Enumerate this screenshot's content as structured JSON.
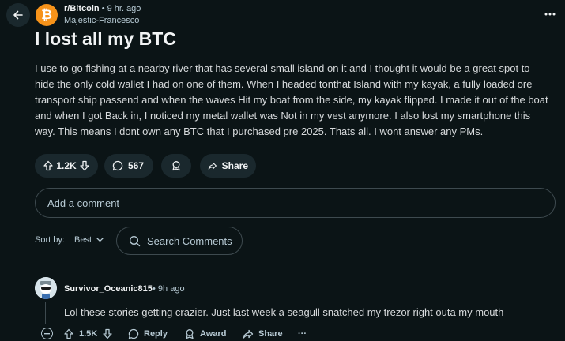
{
  "header": {
    "subreddit": "r/Bitcoin",
    "separator": "•",
    "time_ago": "9 hr. ago",
    "author": "Majestic-Francesco",
    "subreddit_avatar_letter": "₿"
  },
  "post": {
    "title": "I lost all my BTC",
    "body": "I use to go fishing at a nearby river that has several small island on it and I thought it would be a great spot to hide the only cold wallet I had on one of them. When I headed tonthat Island with my kayak, a fully loaded ore transport ship passend and when the waves Hit my boat from the side, my kayak flipped. I made it out of the boat and when I got Back in, I noticed my metal wallet was Not in my vest anymore. I also lost my smartphone this way. This means I dont own any BTC that I purchased pre 2025. Thats all. I wont answer any PMs.",
    "vote_count": "1.2K",
    "comment_count": "567",
    "share_label": "Share"
  },
  "comment_input": {
    "placeholder": "Add a comment"
  },
  "sort": {
    "label": "Sort by:",
    "value": "Best"
  },
  "search_comments": {
    "placeholder": "Search Comments"
  },
  "comments": [
    {
      "author": "Survivor_Oceanic815",
      "separator": "•",
      "time_ago": "9h ago",
      "text": "Lol these stories getting crazier. Just last week a seagull snatched my trezor right outa my mouth",
      "vote_count": "1.5K",
      "reply_label": "Reply",
      "award_label": "Award",
      "share_label": "Share",
      "more_label": "···"
    }
  ],
  "colors": {
    "background": "#0b1416",
    "pill": "#1a282d",
    "bitcoin_orange": "#f7931a",
    "muted_text": "#b7cad4"
  }
}
